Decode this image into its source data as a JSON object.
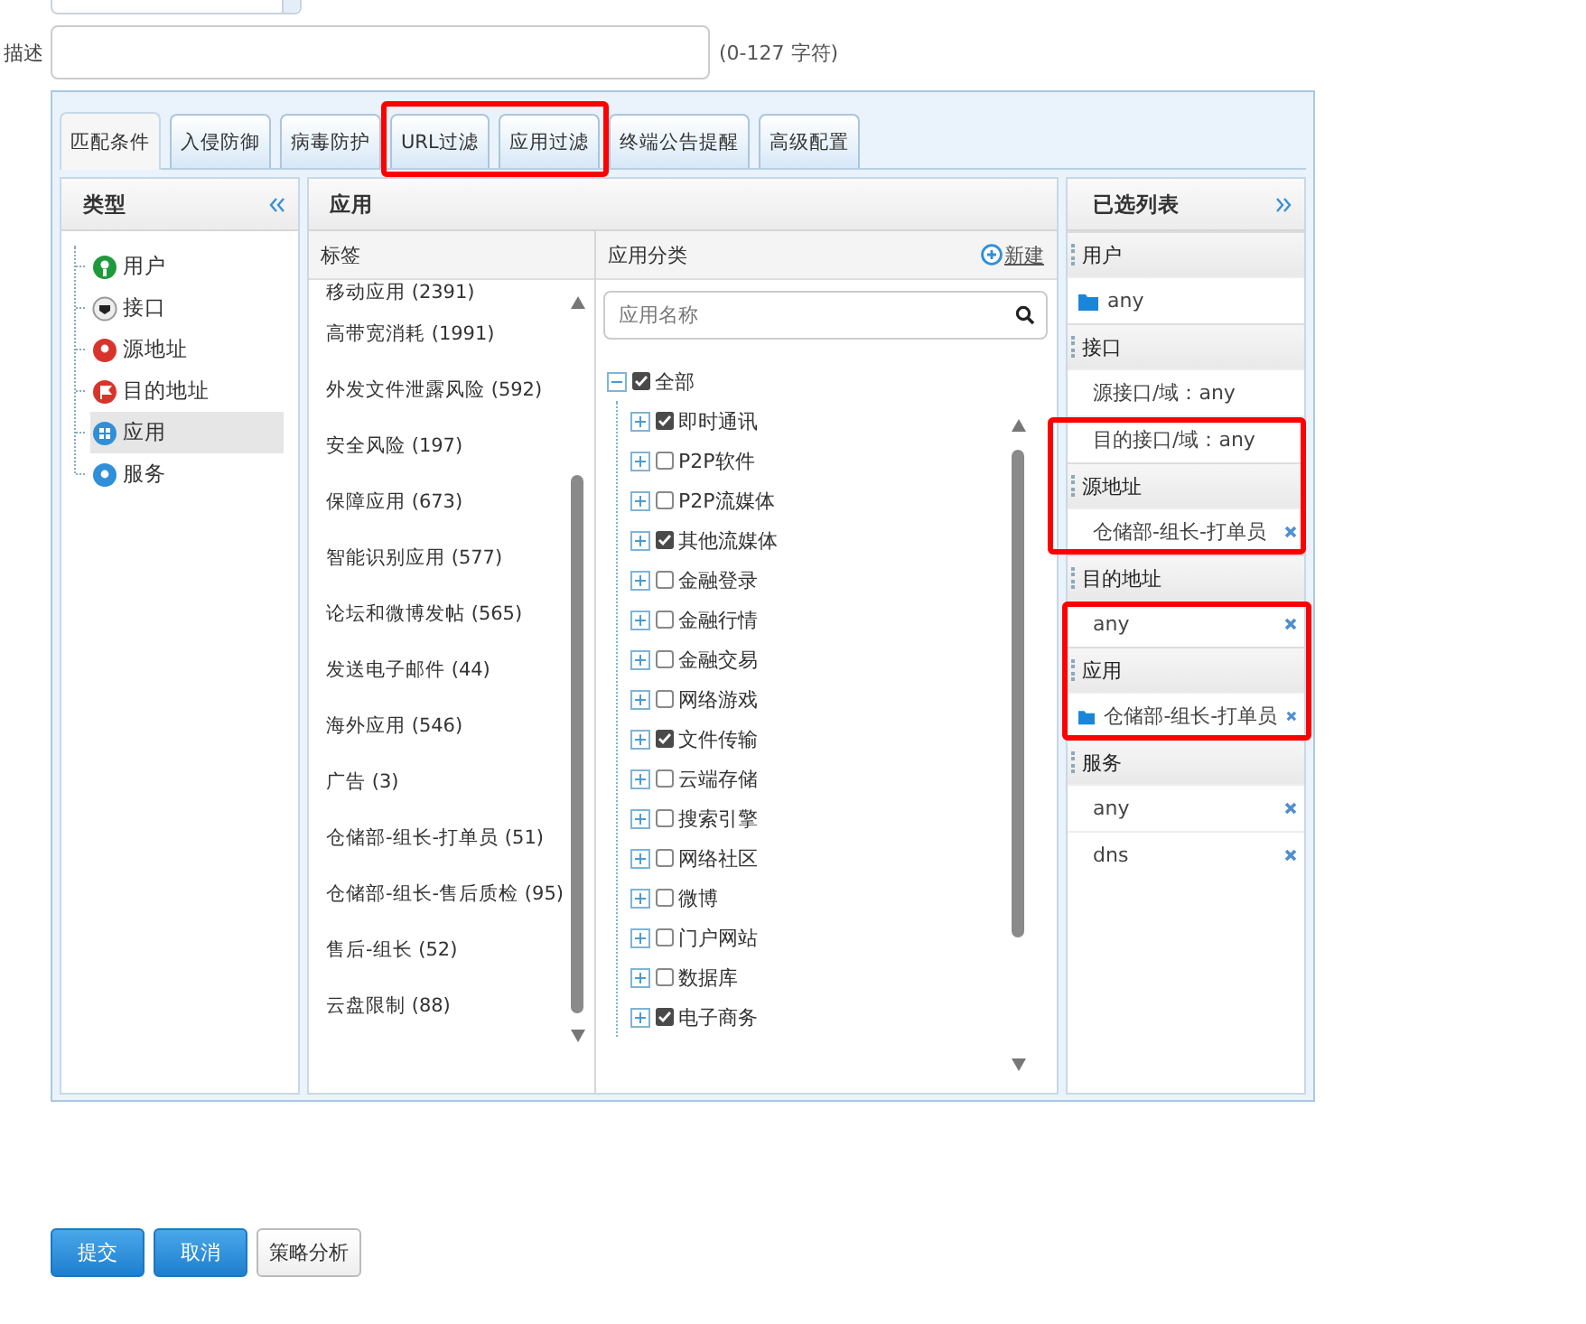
{
  "description": {
    "label": "描述",
    "hint": "(0-127 字符)"
  },
  "tabs": [
    {
      "label": "匹配条件",
      "selected": true
    },
    {
      "label": "入侵防御",
      "selected": false
    },
    {
      "label": "病毒防护",
      "selected": false
    },
    {
      "label": "URL过滤",
      "selected": false
    },
    {
      "label": "应用过滤",
      "selected": false
    },
    {
      "label": "终端公告提醒",
      "selected": false
    },
    {
      "label": "高级配置",
      "selected": false
    }
  ],
  "type_panel": {
    "title": "类型",
    "items": [
      {
        "label": "用户",
        "selected": false
      },
      {
        "label": "接口",
        "selected": false
      },
      {
        "label": "源地址",
        "selected": false
      },
      {
        "label": "目的地址",
        "selected": false
      },
      {
        "label": "应用",
        "selected": true
      },
      {
        "label": "服务",
        "selected": false
      }
    ]
  },
  "app_panel": {
    "title": "应用",
    "labels": {
      "title": "标签",
      "items": [
        "移动应用 (2391)",
        "高带宽消耗 (1991)",
        "外发文件泄露风险 (592)",
        "安全风险 (197)",
        "保障应用 (673)",
        "智能识别应用 (577)",
        "论坛和微博发帖 (565)",
        "发送电子邮件 (44)",
        "海外应用 (546)",
        "广告 (3)",
        "仓储部-组长-打单员 (51)",
        "仓储部-组长-售后质检 (95)",
        "售后-组长 (52)",
        "云盘限制 (88)"
      ]
    },
    "categories": {
      "title": "应用分类",
      "new_link": "新建",
      "search": {
        "placeholder": "应用名称"
      },
      "tree": {
        "label": "全部",
        "checked": true,
        "expanded": true,
        "children": [
          {
            "label": "即时通讯",
            "checked": true,
            "expanded": false
          },
          {
            "label": "P2P软件",
            "checked": false,
            "expanded": false
          },
          {
            "label": "P2P流媒体",
            "checked": false,
            "expanded": false
          },
          {
            "label": "其他流媒体",
            "checked": true,
            "expanded": false
          },
          {
            "label": "金融登录",
            "checked": false,
            "expanded": false
          },
          {
            "label": "金融行情",
            "checked": false,
            "expanded": false
          },
          {
            "label": "金融交易",
            "checked": false,
            "expanded": false
          },
          {
            "label": "网络游戏",
            "checked": false,
            "expanded": false
          },
          {
            "label": "文件传输",
            "checked": true,
            "expanded": false
          },
          {
            "label": "云端存储",
            "checked": false,
            "expanded": false
          },
          {
            "label": "搜索引擎",
            "checked": false,
            "expanded": false
          },
          {
            "label": "网络社区",
            "checked": false,
            "expanded": false
          },
          {
            "label": "微博",
            "checked": false,
            "expanded": false
          },
          {
            "label": "门户网站",
            "checked": false,
            "expanded": false
          },
          {
            "label": "数据库",
            "checked": false,
            "expanded": false
          },
          {
            "label": "电子商务",
            "checked": true,
            "expanded": false
          }
        ]
      }
    }
  },
  "selected_panel": {
    "title": "已选列表",
    "sections": [
      {
        "title": "用户",
        "items": [
          {
            "text": "any",
            "folder": true,
            "removable": false
          }
        ]
      },
      {
        "title": "接口",
        "items": [
          {
            "text": "源接口/域：any",
            "folder": false,
            "removable": false
          },
          {
            "text": "目的接口/域：any",
            "folder": false,
            "removable": false
          }
        ]
      },
      {
        "title": "源地址",
        "items": [
          {
            "text": "仓储部-组长-打单员",
            "folder": false,
            "removable": true
          }
        ]
      },
      {
        "title": "目的地址",
        "items": [
          {
            "text": "any",
            "folder": false,
            "removable": true
          }
        ]
      },
      {
        "title": "应用",
        "items": [
          {
            "text": "仓储部-组长-打单员",
            "folder": true,
            "removable": true
          }
        ]
      },
      {
        "title": "服务",
        "items": [
          {
            "text": "any",
            "folder": false,
            "removable": true
          },
          {
            "text": "dns",
            "folder": false,
            "removable": true
          }
        ]
      }
    ]
  },
  "buttons": [
    {
      "label": "提交",
      "kind": "primary"
    },
    {
      "label": "取消",
      "kind": "primary"
    },
    {
      "label": "策略分析",
      "kind": "secondary"
    }
  ]
}
